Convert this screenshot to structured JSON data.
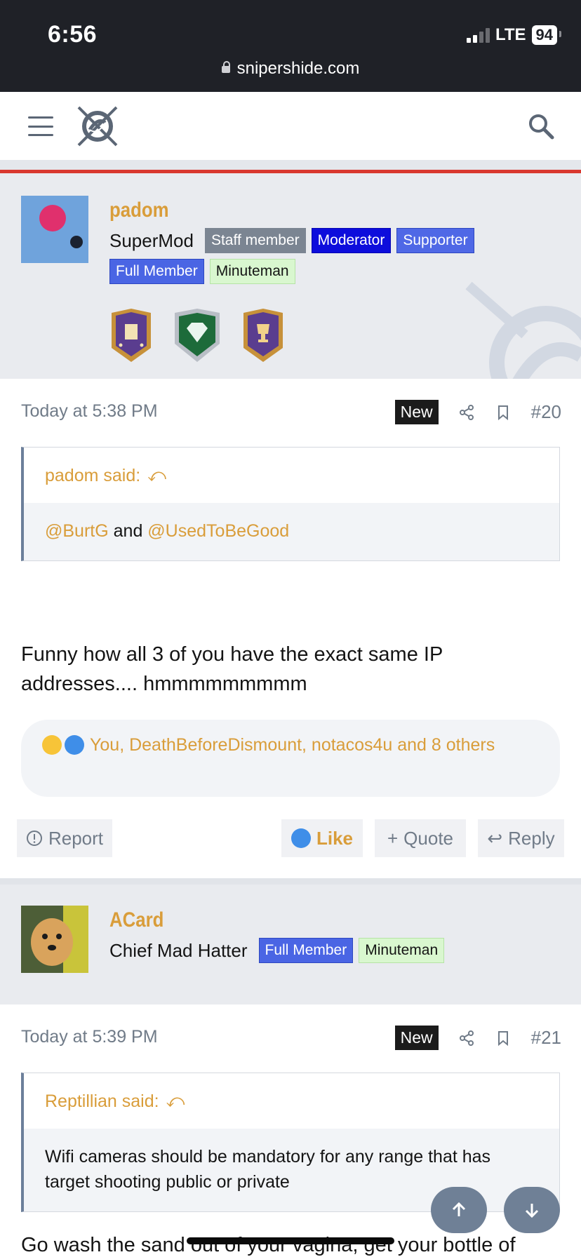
{
  "status": {
    "time": "6:56",
    "network": "LTE",
    "battery": "94"
  },
  "browser": {
    "url": "snipershide.com"
  },
  "posts": [
    {
      "username": "padom",
      "user_title": "SuperMod",
      "badges": [
        "Staff member",
        "Moderator",
        "Supporter",
        "Full Member",
        "Minuteman"
      ],
      "date": "Today at 5:38 PM",
      "new_label": "New",
      "number": "#20",
      "quote": {
        "author": "padom said:",
        "mention_1": "@BurtG",
        "joiner": " and ",
        "mention_2": "@UsedToBeGood"
      },
      "body": "Funny how all 3 of you have the exact same IP addresses.... hmmmmmmmmm",
      "reactions_text": "You, DeathBeforeDismount, notacos4u and 8 others",
      "actions": {
        "report": "Report",
        "like": "Like",
        "quote": "Quote",
        "reply": "Reply"
      }
    },
    {
      "username": "ACard",
      "user_title": "Chief Mad Hatter",
      "badges": [
        "Full Member",
        "Minuteman"
      ],
      "date": "Today at 5:39 PM",
      "new_label": "New",
      "number": "#21",
      "quote": {
        "author": "Reptillian said:",
        "text": "Wifi cameras should be mandatory for any range that has target shooting public or private"
      },
      "body": "Go wash the sand out of your vagina, get your bottle of"
    }
  ],
  "colors": {
    "accent": "#d99d3a",
    "header_dark": "#1f2127",
    "red_rule": "#d9382f"
  }
}
